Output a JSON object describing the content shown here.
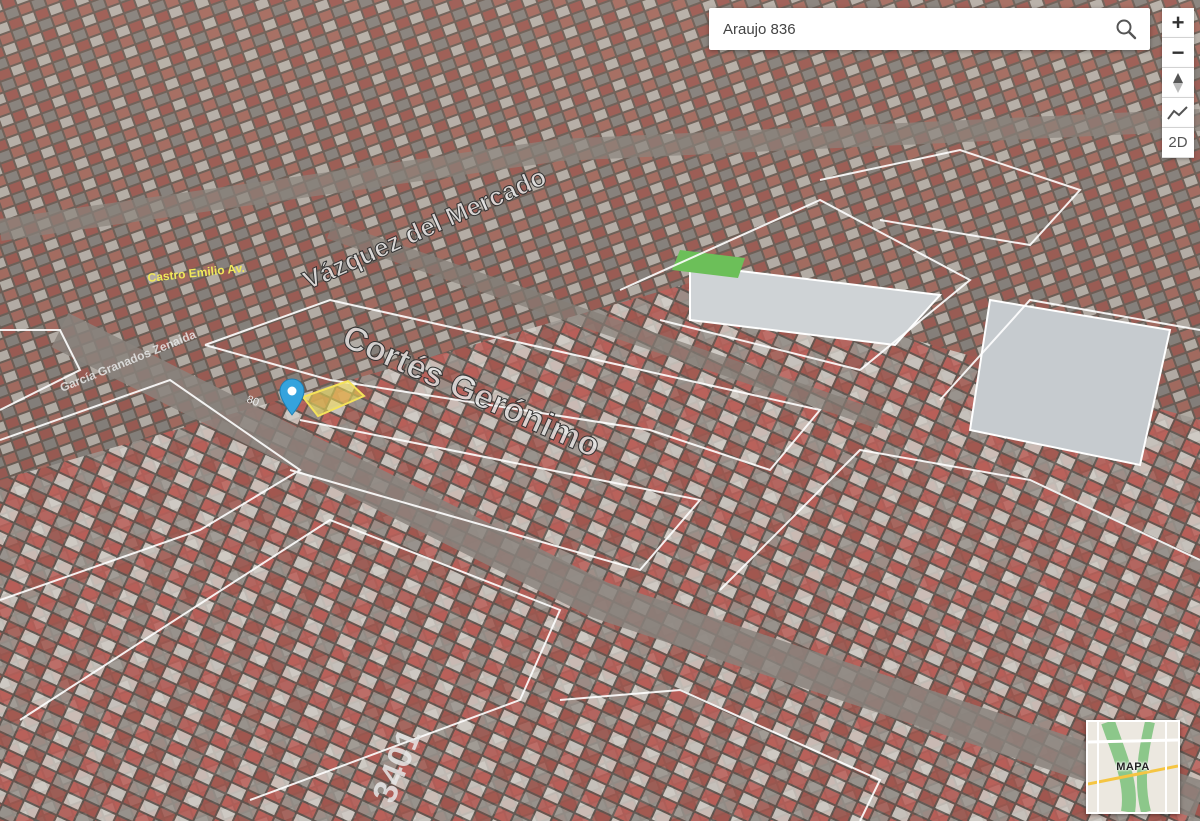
{
  "search": {
    "value": "Araujo 836"
  },
  "controls": {
    "zoom_in": "+",
    "zoom_out": "−",
    "view_2d": "2D"
  },
  "minimap": {
    "label": "MAPA"
  },
  "streets": [
    {
      "id": "castro-emilio",
      "label": "Castro Emilio Av.",
      "color": "#f1e95a"
    },
    {
      "id": "vazquez-del-mercado",
      "label": "Vázquez del Mercado",
      "color": "#e8e8e8"
    },
    {
      "id": "garcia-granados",
      "label": "García Granados Zenaida",
      "color": "#e8e8e8"
    },
    {
      "id": "cortes-geronimo",
      "label": "Cortés Gerónimo",
      "color": "#e8e8e8"
    },
    {
      "id": "street-80",
      "label": "80",
      "color": "#e8e8e8"
    },
    {
      "id": "street-3401",
      "label": "3401",
      "color": "#e8e8e8"
    }
  ],
  "colors": {
    "accent_marker": "#35a3dd",
    "selected_parcel": "#f5e35a",
    "parcel_outline": "#ffffff"
  }
}
